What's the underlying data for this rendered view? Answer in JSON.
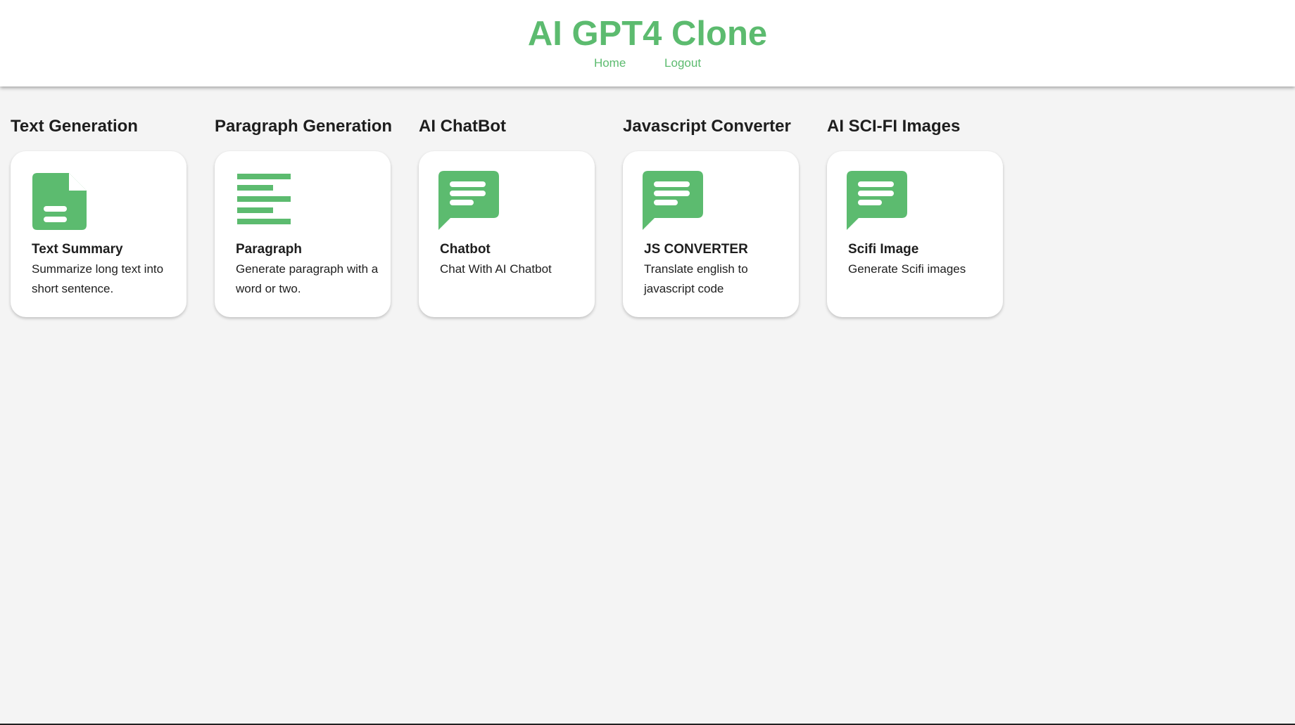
{
  "header": {
    "title": "AI GPT4 Clone",
    "nav": [
      {
        "label": "Home"
      },
      {
        "label": "Logout"
      }
    ]
  },
  "features": [
    {
      "heading": "Text Generation",
      "icon": "description-icon",
      "title": "Text Summary",
      "description": "Summarize long text into short sentence."
    },
    {
      "heading": "Paragraph Generation",
      "icon": "format-align-left-icon",
      "title": "Paragraph",
      "description": "Generate paragraph with a word or two."
    },
    {
      "heading": "AI ChatBot",
      "icon": "chat-icon",
      "title": "Chatbot",
      "description": "Chat With AI Chatbot"
    },
    {
      "heading": "Javascript Converter",
      "icon": "chat-icon",
      "title": "JS CONVERTER",
      "description": "Translate english to javascript code"
    },
    {
      "heading": "AI SCI-FI Images",
      "icon": "chat-icon",
      "title": "Scifi Image",
      "description": "Generate Scifi images"
    }
  ],
  "colors": {
    "accent": "#5cbb6f",
    "background": "#f4f4f4",
    "card": "#ffffff",
    "text": "#1e1e1e"
  }
}
